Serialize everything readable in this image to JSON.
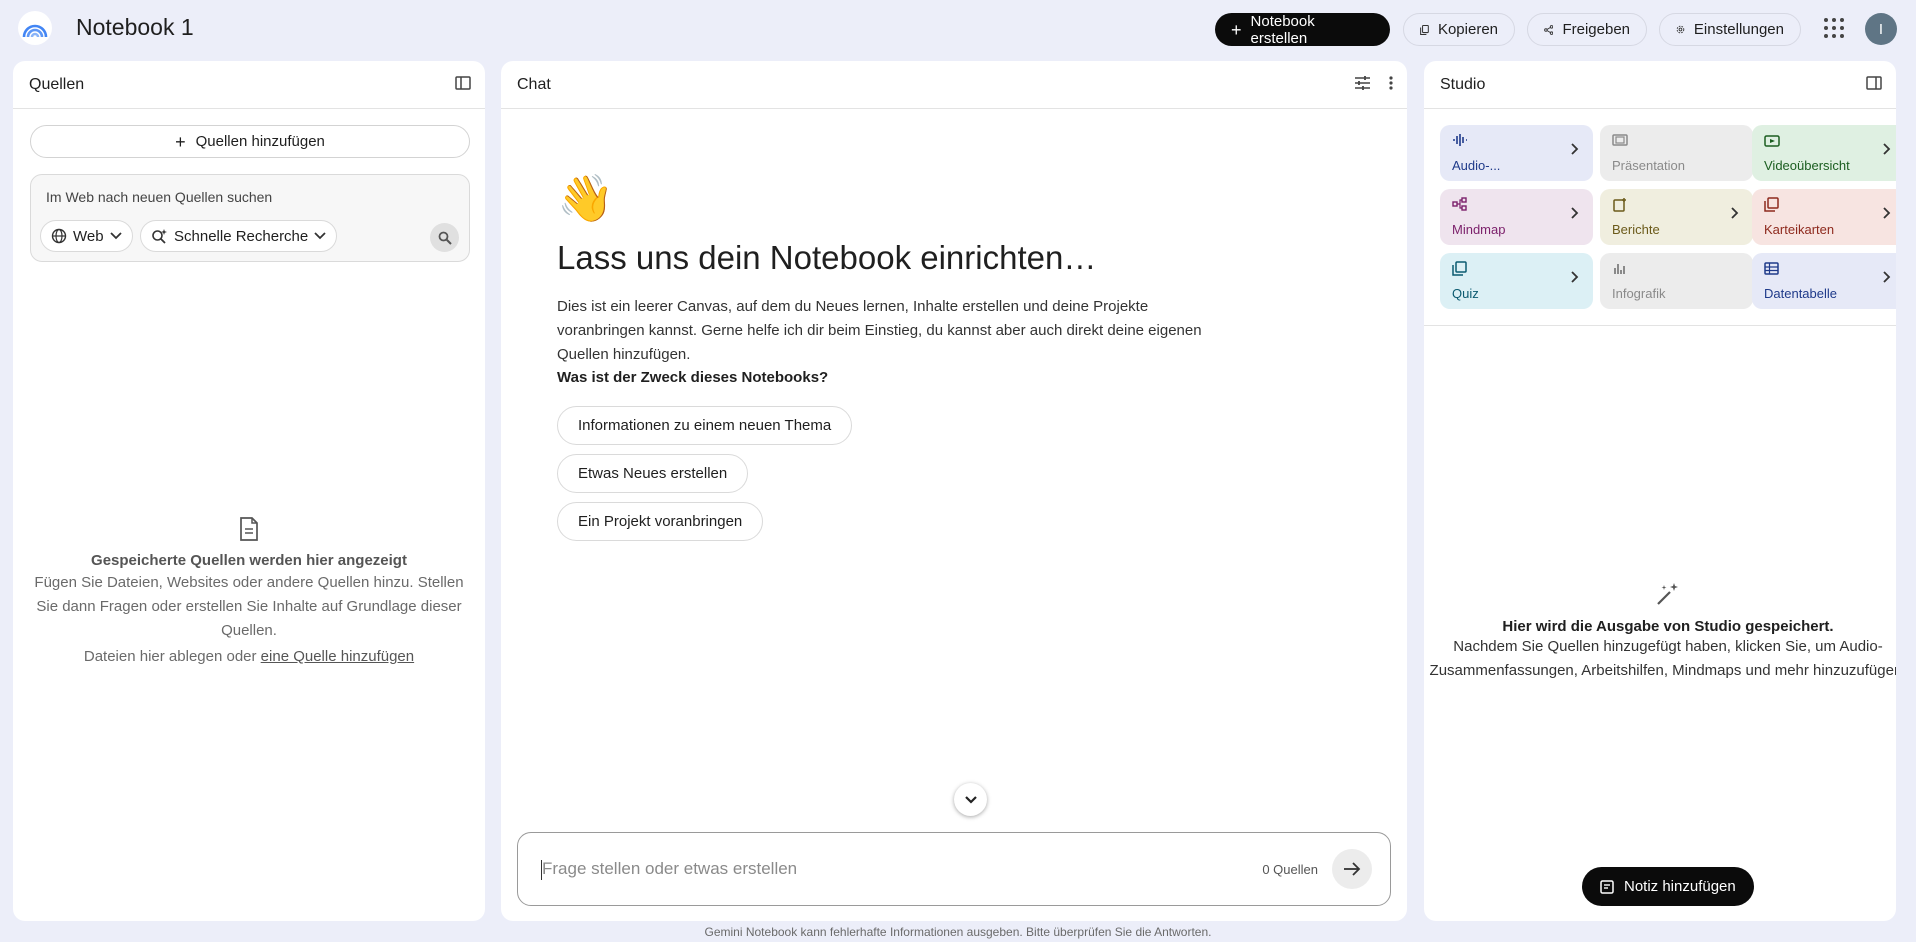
{
  "header": {
    "title": "Notebook 1",
    "create_label": "Notebook erstellen",
    "copy_label": "Kopieren",
    "share_label": "Freigeben",
    "settings_label": "Einstellungen",
    "avatar_initial": "I"
  },
  "sources": {
    "title": "Quellen",
    "add_label": "Quellen hinzufügen",
    "search_placeholder": "Im Web nach neuen Quellen suchen",
    "web_chip": "Web",
    "research_chip": "Schnelle Recherche",
    "empty_title": "Gespeicherte Quellen werden hier angezeigt",
    "empty_text": "Fügen Sie Dateien, Websites oder andere Quellen hinzu. Stellen Sie dann Fragen oder erstellen Sie Inhalte auf Grundlage dieser Quellen.",
    "drop_text": "Dateien hier ablegen oder ",
    "drop_link": "eine Quelle hinzufügen"
  },
  "chat": {
    "title": "Chat",
    "wave": "👋",
    "heading": "Lass uns dein Notebook einrichten…",
    "intro": "Dies ist ein leerer Canvas, auf dem du Neues lernen, Inhalte erstellen und deine Projekte voranbringen kannst. Gerne helfe ich dir beim Einstieg, du kannst aber auch direkt deine eigenen Quellen hinzufügen.",
    "question": "Was ist der Zweck dieses Notebooks?",
    "suggestions": [
      "Informationen zu einem neuen Thema",
      "Etwas Neues erstellen",
      "Ein Projekt voranbringen"
    ],
    "input_placeholder": "Frage stellen oder etwas erstellen",
    "source_count": "0 Quellen"
  },
  "studio": {
    "title": "Studio",
    "tiles": [
      {
        "label": "Audio-...",
        "icon": "audio-wave-icon",
        "bg": "#e6e9f7",
        "fg": "#1f3a8a",
        "enabled": true
      },
      {
        "label": "Präsentation",
        "icon": "slides-icon",
        "bg": "#ececec",
        "fg": "#8a8a8a",
        "enabled": false
      },
      {
        "label": "Videoübersicht",
        "icon": "video-icon",
        "bg": "#dff0e2",
        "fg": "#1b5e20",
        "enabled": true
      },
      {
        "label": "Mindmap",
        "icon": "mindmap-icon",
        "bg": "#efe4ee",
        "fg": "#7b1f6a",
        "enabled": true
      },
      {
        "label": "Berichte",
        "icon": "reports-icon",
        "bg": "#f0eedf",
        "fg": "#6b5a1a",
        "enabled": true
      },
      {
        "label": "Karteikarten",
        "icon": "flashcards-icon",
        "bg": "#f7e4e1",
        "fg": "#8e2a1e",
        "enabled": true
      },
      {
        "label": "Quiz",
        "icon": "quiz-icon",
        "bg": "#dcf0f5",
        "fg": "#0b5a70",
        "enabled": true
      },
      {
        "label": "Infografik",
        "icon": "infographic-icon",
        "bg": "#ececec",
        "fg": "#8a8a8a",
        "enabled": false
      },
      {
        "label": "Datentabelle",
        "icon": "datatable-icon",
        "bg": "#e6e9f7",
        "fg": "#1f3a8a",
        "enabled": true
      }
    ],
    "empty_title": "Hier wird die Ausgabe von Studio gespeichert.",
    "empty_text": "Nachdem Sie Quellen hinzugefügt haben, klicken Sie, um Audio-Zusammenfassungen, Arbeitshilfen, Mindmaps und mehr hinzuzufügen.",
    "note_label": "Notiz hinzufügen"
  },
  "footer": {
    "disclaimer": "Gemini Notebook kann fehlerhafte Informationen ausgeben. Bitte überprüfen Sie die Antworten."
  }
}
